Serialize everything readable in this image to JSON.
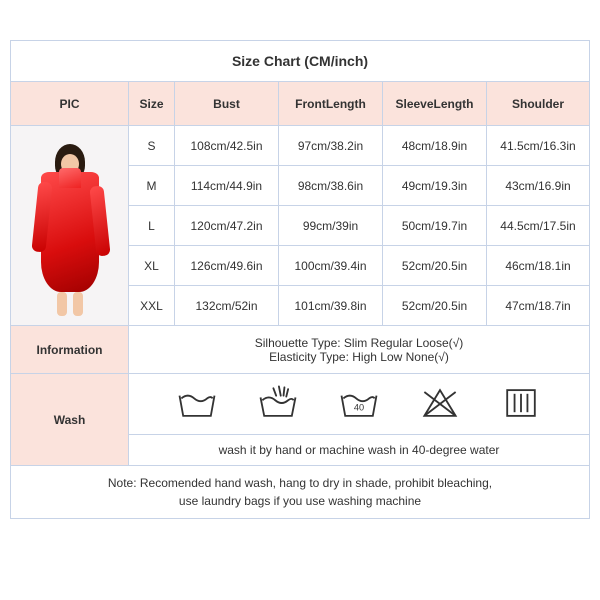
{
  "title": "Size Chart  (CM/inch)",
  "headers": {
    "pic": "PIC",
    "size": "Size",
    "bust": "Bust",
    "front": "FrontLength",
    "sleeve": "SleeveLength",
    "shoulder": "Shoulder"
  },
  "rows": [
    {
      "size": "S",
      "bust": "108cm/42.5in",
      "front": "97cm/38.2in",
      "sleeve": "48cm/18.9in",
      "shoulder": "41.5cm/16.3in"
    },
    {
      "size": "M",
      "bust": "114cm/44.9in",
      "front": "98cm/38.6in",
      "sleeve": "49cm/19.3in",
      "shoulder": "43cm/16.9in"
    },
    {
      "size": "L",
      "bust": "120cm/47.2in",
      "front": "99cm/39in",
      "sleeve": "50cm/19.7in",
      "shoulder": "44.5cm/17.5in"
    },
    {
      "size": "XL",
      "bust": "126cm/49.6in",
      "front": "100cm/39.4in",
      "sleeve": "52cm/20.5in",
      "shoulder": "46cm/18.1in"
    },
    {
      "size": "XXL",
      "bust": "132cm/52in",
      "front": "101cm/39.8in",
      "sleeve": "52cm/20.5in",
      "shoulder": "47cm/18.7in"
    }
  ],
  "info": {
    "label": "Information",
    "silhouette": "Silhouette Type: Slim  Regular  Loose(√)",
    "elasticity": "Elasticity Type: High  Low  None(√)"
  },
  "wash": {
    "label": "Wash",
    "text": "wash it by hand or machine wash in 40-degree water"
  },
  "note": {
    "line1": "Note: Recomended hand wash, hang to dry in shade, prohibit bleaching,",
    "line2": "use laundry bags if you use washing machine"
  },
  "chart_data": {
    "type": "table",
    "title": "Size Chart (CM/inch)",
    "columns": [
      "Size",
      "Bust",
      "FrontLength",
      "SleeveLength",
      "Shoulder"
    ],
    "rows": [
      [
        "S",
        "108cm/42.5in",
        "97cm/38.2in",
        "48cm/18.9in",
        "41.5cm/16.3in"
      ],
      [
        "M",
        "114cm/44.9in",
        "98cm/38.6in",
        "49cm/19.3in",
        "43cm/16.9in"
      ],
      [
        "L",
        "120cm/47.2in",
        "99cm/39in",
        "50cm/19.7in",
        "44.5cm/17.5in"
      ],
      [
        "XL",
        "126cm/49.6in",
        "100cm/39.4in",
        "52cm/20.5in",
        "46cm/18.1in"
      ],
      [
        "XXL",
        "132cm/52in",
        "101cm/39.8in",
        "52cm/20.5in",
        "47cm/18.7in"
      ]
    ]
  }
}
